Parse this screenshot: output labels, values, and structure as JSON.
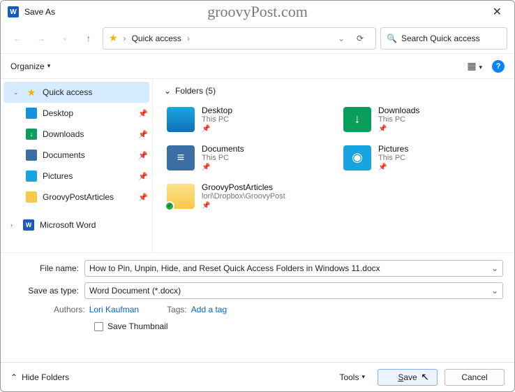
{
  "watermark": "groovyPost.com",
  "title": "Save As",
  "nav": {
    "path_label": "Quick access",
    "refresh_tip": "Refresh",
    "search_placeholder": "Search Quick access"
  },
  "toolbar": {
    "organize": "Organize",
    "help": "?"
  },
  "sidebar": {
    "items": [
      {
        "label": "Quick access",
        "icon": "star",
        "selected": true,
        "chev": "⌄"
      },
      {
        "label": "Desktop",
        "icon": "desk",
        "pinned": true,
        "sub": true
      },
      {
        "label": "Downloads",
        "icon": "dl",
        "pinned": true,
        "sub": true
      },
      {
        "label": "Documents",
        "icon": "doc",
        "pinned": true,
        "sub": true
      },
      {
        "label": "Pictures",
        "icon": "pic",
        "pinned": true,
        "sub": true
      },
      {
        "label": "GroovyPostArticles",
        "icon": "fold",
        "pinned": true,
        "sub": true
      },
      {
        "label": "Microsoft Word",
        "icon": "word",
        "chev": "›"
      }
    ]
  },
  "content": {
    "group_label": "Folders (5)",
    "tiles": [
      {
        "name": "Desktop",
        "sub": "This PC",
        "icon": "desk"
      },
      {
        "name": "Downloads",
        "sub": "This PC",
        "icon": "dl"
      },
      {
        "name": "Documents",
        "sub": "This PC",
        "icon": "doc"
      },
      {
        "name": "Pictures",
        "sub": "This PC",
        "icon": "pic"
      },
      {
        "name": "GroovyPostArticles",
        "sub": "lori\\Dropbox\\GroovyPost",
        "icon": "fold",
        "sync": true
      }
    ]
  },
  "form": {
    "filename_label": "File name:",
    "filename_value": "How to Pin, Unpin, Hide, and Reset Quick Access Folders in Windows 11.docx",
    "type_label": "Save as type:",
    "type_value": "Word Document (*.docx)",
    "authors_label": "Authors:",
    "authors_value": "Lori Kaufman",
    "tags_label": "Tags:",
    "tags_value": "Add a tag",
    "thumb_label": "Save Thumbnail"
  },
  "footer": {
    "hide": "Hide Folders",
    "tools": "Tools",
    "save": "Save",
    "cancel": "Cancel"
  }
}
